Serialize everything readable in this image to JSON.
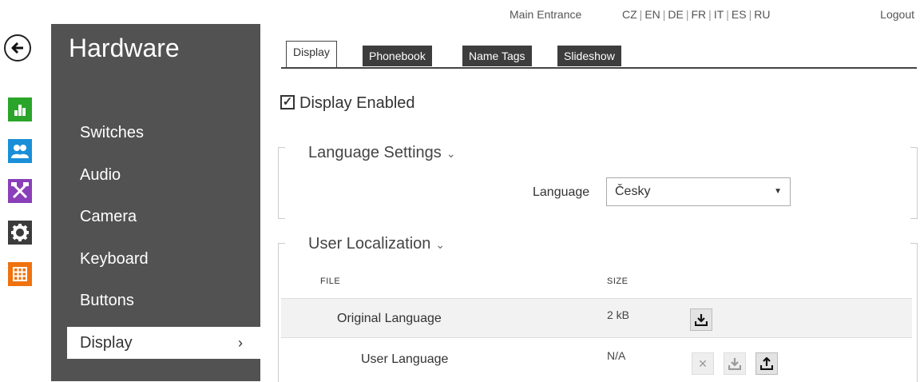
{
  "topbar": {
    "device_name": "Main Entrance",
    "languages": [
      "CZ",
      "EN",
      "DE",
      "FR",
      "IT",
      "ES",
      "RU"
    ],
    "logout": "Logout"
  },
  "strip": {
    "back_icon": "back-arrow-icon",
    "icons": [
      {
        "name": "status-chart-icon",
        "color": "#2aa52a"
      },
      {
        "name": "directory-users-icon",
        "color": "#1a8fd8"
      },
      {
        "name": "hardware-tools-icon",
        "color": "#8a3fb8"
      },
      {
        "name": "system-gear-icon",
        "color": "#3c3c3c"
      },
      {
        "name": "services-grid-icon",
        "color": "#f0720f"
      }
    ]
  },
  "sidebar": {
    "title": "Hardware",
    "items": [
      {
        "label": "Switches"
      },
      {
        "label": "Audio"
      },
      {
        "label": "Camera"
      },
      {
        "label": "Keyboard"
      },
      {
        "label": "Buttons"
      },
      {
        "label": "Display",
        "active": true
      }
    ]
  },
  "tabs": [
    {
      "label": "Display",
      "active": true
    },
    {
      "label": "Phonebook"
    },
    {
      "label": "Name Tags"
    },
    {
      "label": "Slideshow"
    }
  ],
  "display_enabled": {
    "label": "Display Enabled",
    "checked": true
  },
  "language_settings": {
    "title": "Language Settings",
    "language_label": "Language",
    "language_value": "Česky"
  },
  "user_localization": {
    "title": "User Localization",
    "columns": [
      "FILE",
      "SIZE"
    ],
    "rows": [
      {
        "file": "Original Language",
        "size": "2 kB"
      },
      {
        "file": "User Language",
        "size": "N/A"
      }
    ]
  }
}
